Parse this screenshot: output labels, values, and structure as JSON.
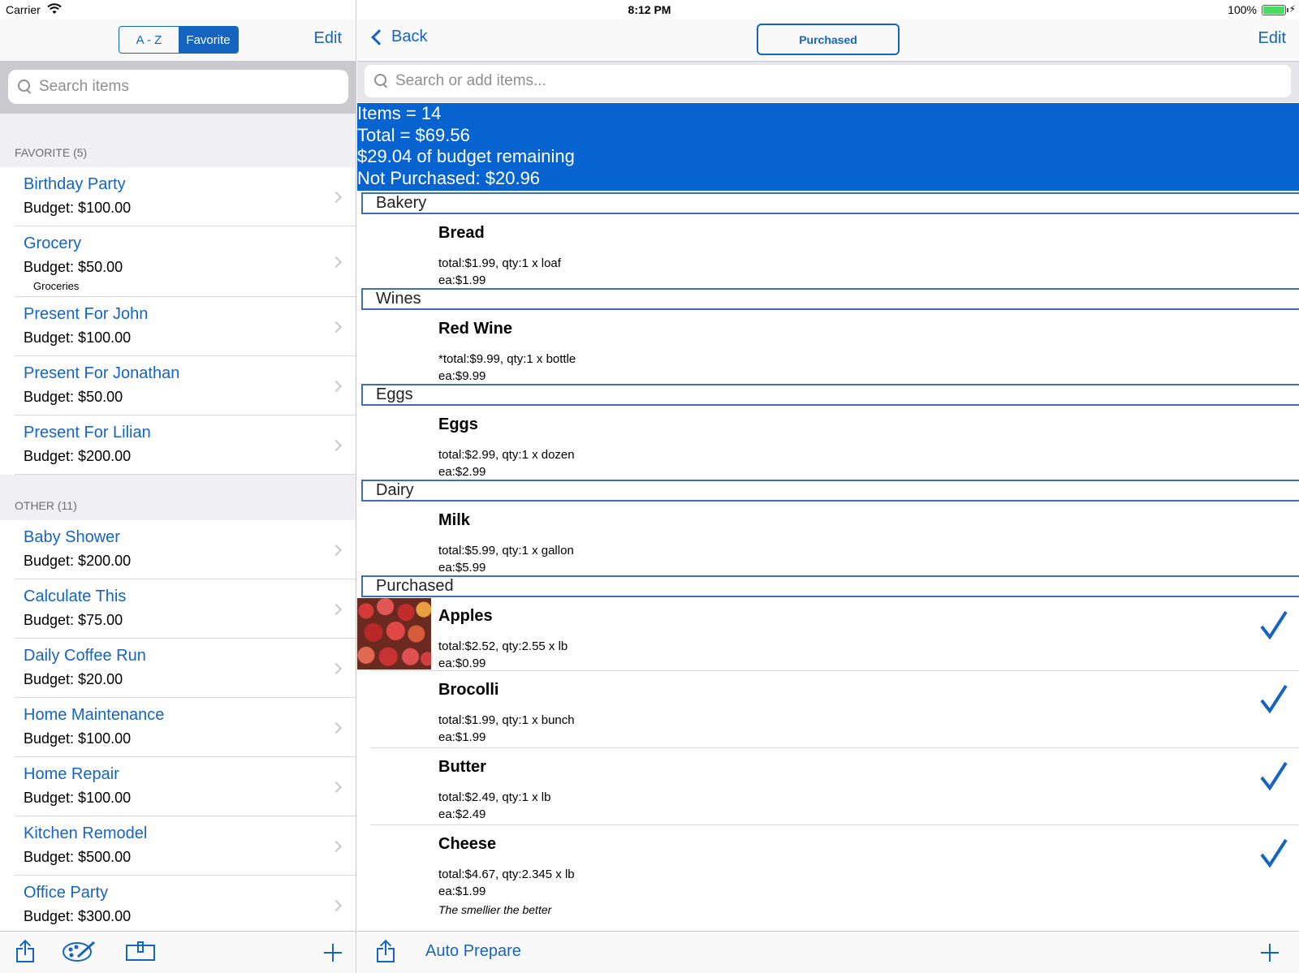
{
  "status": {
    "carrier": "Carrier",
    "time": "8:12 PM",
    "battery": "100%"
  },
  "left": {
    "segments": [
      "A - Z",
      "Favorite"
    ],
    "active_segment": 1,
    "edit_label": "Edit",
    "search_placeholder": "Search items",
    "sections": [
      {
        "header": "FAVORITE (5)",
        "items": [
          {
            "title": "Birthday Party",
            "budget": "Budget: $100.00",
            "note": ""
          },
          {
            "title": "Grocery",
            "budget": "Budget: $50.00",
            "note": "Groceries"
          },
          {
            "title": "Present For John",
            "budget": "Budget: $100.00",
            "note": ""
          },
          {
            "title": "Present For Jonathan",
            "budget": "Budget: $50.00",
            "note": ""
          },
          {
            "title": "Present For Lilian",
            "budget": "Budget: $200.00",
            "note": ""
          }
        ]
      },
      {
        "header": "OTHER (11)",
        "items": [
          {
            "title": "Baby Shower",
            "budget": "Budget: $200.00",
            "note": ""
          },
          {
            "title": "Calculate This",
            "budget": "Budget: $75.00",
            "note": ""
          },
          {
            "title": "Daily Coffee Run",
            "budget": "Budget: $20.00",
            "note": ""
          },
          {
            "title": "Home Maintenance",
            "budget": "Budget: $100.00",
            "note": ""
          },
          {
            "title": "Home Repair",
            "budget": "Budget: $100.00",
            "note": ""
          },
          {
            "title": "Kitchen Remodel",
            "budget": "Budget: $500.00",
            "note": ""
          },
          {
            "title": "Office Party",
            "budget": "Budget: $300.00",
            "note": ""
          }
        ]
      }
    ],
    "toolbar_icons": [
      "share-icon",
      "palette-icon",
      "import-icon",
      "plus-icon"
    ]
  },
  "right": {
    "back_label": "Back",
    "purchased_button": "Purchased",
    "edit_label": "Edit",
    "search_placeholder": "Search or add items...",
    "summary": {
      "items": "Items = 14",
      "total": "Total = $69.56",
      "remaining": "$29.04 of budget remaining",
      "not_purchased": "Not Purchased: $20.96"
    },
    "groups": [
      {
        "category": "Bakery",
        "items": [
          {
            "name": "Bread",
            "line1": "total:$1.99, qty:1 x loaf",
            "line2": "ea:$1.99",
            "checked": false
          }
        ]
      },
      {
        "category": "Wines",
        "items": [
          {
            "name": "Red Wine",
            "line1": "*total:$9.99, qty:1 x bottle",
            "line2": "ea:$9.99",
            "checked": false
          }
        ]
      },
      {
        "category": "Eggs",
        "items": [
          {
            "name": "Eggs",
            "line1": "total:$2.99, qty:1 x dozen",
            "line2": "ea:$2.99",
            "checked": false
          }
        ]
      },
      {
        "category": "Dairy",
        "items": [
          {
            "name": "Milk",
            "line1": "total:$5.99, qty:1 x gallon",
            "line2": "ea:$5.99",
            "checked": false
          }
        ]
      },
      {
        "category": "Purchased",
        "items": [
          {
            "name": "Apples",
            "line1": "total:$2.52, qty:2.55 x lb",
            "line2": "ea:$0.99",
            "checked": true,
            "image": "apples-photo"
          },
          {
            "name": "Brocolli",
            "line1": "total:$1.99, qty:1 x bunch",
            "line2": "ea:$1.99",
            "checked": true
          },
          {
            "name": "Butter",
            "line1": "total:$2.49, qty:1 x lb",
            "line2": "ea:$2.49",
            "checked": true
          },
          {
            "name": "Cheese",
            "line1": "total:$4.67, qty:2.345 x lb",
            "line2": "ea:$1.99",
            "note": "The smellier the better",
            "checked": true
          }
        ]
      }
    ],
    "auto_prepare_label": "Auto Prepare",
    "accent": "#1565c0",
    "summary_bg": "#0663cf"
  }
}
